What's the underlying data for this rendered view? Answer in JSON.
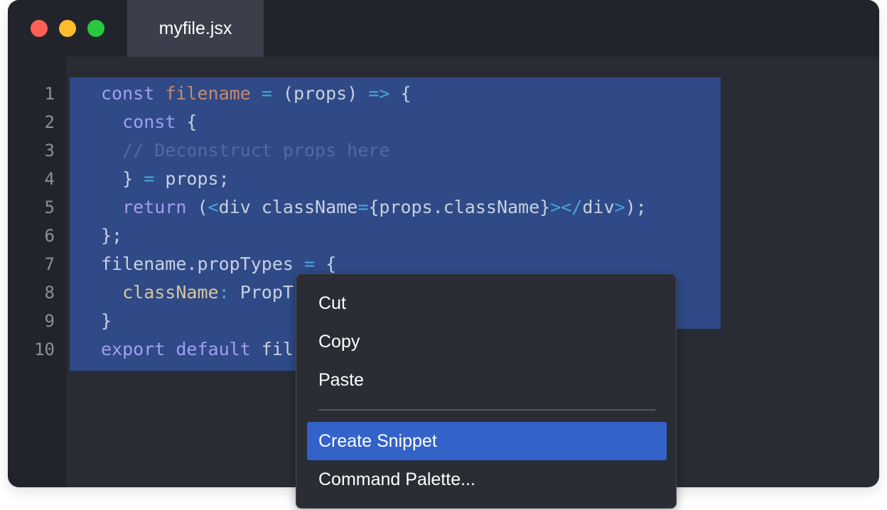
{
  "window": {
    "tab_title": "myfile.jsx"
  },
  "editor": {
    "line_numbers": [
      "1",
      "2",
      "3",
      "4",
      "5",
      "6",
      "7",
      "8",
      "9",
      "10"
    ],
    "lines": [
      [
        {
          "t": "const ",
          "c": "kw"
        },
        {
          "t": "filename",
          "c": "var"
        },
        {
          "t": " = ",
          "c": "op"
        },
        {
          "t": "(props) ",
          "c": "id"
        },
        {
          "t": "=>",
          "c": "op"
        },
        {
          "t": " {",
          "c": "pun"
        }
      ],
      [
        {
          "t": "  const ",
          "c": "kw"
        },
        {
          "t": "{",
          "c": "pun"
        }
      ],
      [
        {
          "t": "  // Deconstruct props here",
          "c": "cm"
        }
      ],
      [
        {
          "t": "  } ",
          "c": "pun"
        },
        {
          "t": "=",
          "c": "op"
        },
        {
          "t": " props;",
          "c": "id"
        }
      ],
      [
        {
          "t": "  return ",
          "c": "kw"
        },
        {
          "t": "(",
          "c": "pun"
        },
        {
          "t": "<",
          "c": "op"
        },
        {
          "t": "div className",
          "c": "id"
        },
        {
          "t": "=",
          "c": "op"
        },
        {
          "t": "{props.className}",
          "c": "id"
        },
        {
          "t": "></",
          "c": "op"
        },
        {
          "t": "div",
          "c": "id"
        },
        {
          "t": ">",
          "c": "op"
        },
        {
          "t": ");",
          "c": "pun"
        }
      ],
      [
        {
          "t": "};",
          "c": "pun"
        }
      ],
      [
        {
          "t": "filename.propTypes ",
          "c": "id"
        },
        {
          "t": "=",
          "c": "op"
        },
        {
          "t": " {",
          "c": "pun"
        }
      ],
      [
        {
          "t": "  className",
          "c": "prop"
        },
        {
          "t": ": ",
          "c": "op"
        },
        {
          "t": "PropT",
          "c": "id"
        }
      ],
      [
        {
          "t": "}",
          "c": "pun"
        }
      ],
      [
        {
          "t": "export default ",
          "c": "kw"
        },
        {
          "t": "fil",
          "c": "id"
        }
      ]
    ]
  },
  "context_menu": {
    "cut": "Cut",
    "copy": "Copy",
    "paste": "Paste",
    "create_snippet": "Create Snippet",
    "command_palette": "Command Palette..."
  }
}
